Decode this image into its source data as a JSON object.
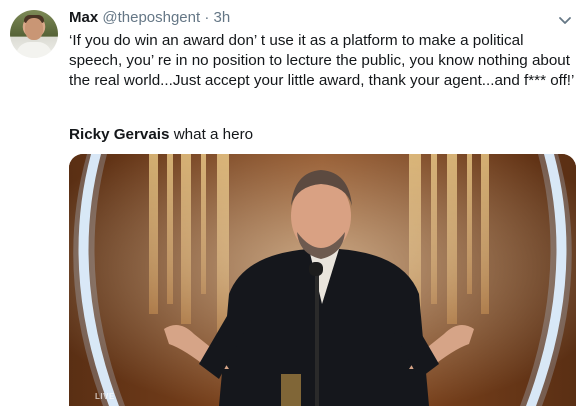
{
  "tweet": {
    "author_name": "Max",
    "author_handle": "@theposhgent",
    "separator": "·",
    "time": "3h",
    "text": "‘If you do win an award don’ t use it as a platform to make a political speech, you’ re in no position to lecture the public, you know nothing about the real world...Just accept your little award, thank your agent...and f*** off!’",
    "mention_bold": "Ricky Gervais",
    "mention_rest": " what a hero",
    "media_overlay_text": "LIVE"
  },
  "icons": {
    "avatar": "user-avatar",
    "caret": "chevron-down-icon"
  },
  "colors": {
    "text": "#14171a",
    "secondary": "#657786",
    "stage_background": "#6b3b17",
    "stage_light": "#e8f4ff"
  }
}
